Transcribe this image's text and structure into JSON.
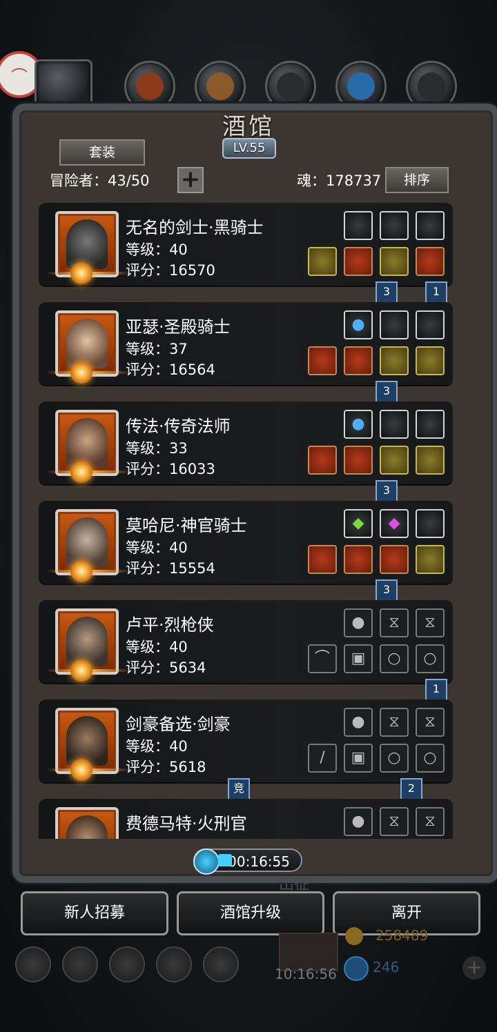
{
  "header": {
    "title": "酒馆",
    "level": "LV.55",
    "tab_suit": "套装",
    "adventurers_label": "冒险者：43/50",
    "soul_label": "魂：178737",
    "sort_button": "排序"
  },
  "heroes": [
    {
      "name": "无名的剑士·黑骑士",
      "level": "等级：40",
      "score": "评分：16570"
    },
    {
      "name": "亚瑟·圣殿骑士",
      "level": "等级：37",
      "score": "评分：16564"
    },
    {
      "name": "传法·传奇法师",
      "level": "等级：33",
      "score": "评分：16033"
    },
    {
      "name": "莫哈尼·神官骑士",
      "level": "等级：40",
      "score": "评分：15554"
    },
    {
      "name": "卢平·烈枪侠",
      "level": "等级：40",
      "score": "评分：5634"
    },
    {
      "name": "剑豪备选·剑豪",
      "level": "等级：40",
      "score": "评分：5618"
    },
    {
      "name": "费德马特·火刑官",
      "level": "",
      "score": ""
    }
  ],
  "flags": {
    "f1a": "3",
    "f1b": "1",
    "f2": "3",
    "f3": "3",
    "f4": "3",
    "f5": "1",
    "f6a": "竞",
    "f6b": "2"
  },
  "footer": {
    "timer": "00:16:55",
    "recruit_button": "新人招募",
    "upgrade_button": "酒馆升级",
    "leave_button": "离开",
    "bg_expedition": "出征",
    "bg_gold": "258489",
    "bg_gems": "246",
    "bg_clock": "10:16:56"
  }
}
